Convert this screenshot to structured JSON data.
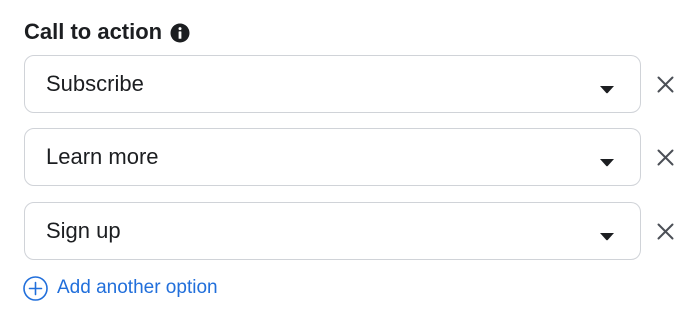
{
  "section": {
    "title": "Call to action",
    "info_icon": "info-icon"
  },
  "options": [
    {
      "value": "Subscribe",
      "dropdown_icon": "caret-down-icon",
      "remove_icon": "close-icon"
    },
    {
      "value": "Learn more",
      "dropdown_icon": "caret-down-icon",
      "remove_icon": "close-icon"
    },
    {
      "value": "Sign up",
      "dropdown_icon": "caret-down-icon",
      "remove_icon": "close-icon"
    }
  ],
  "add_option": {
    "label": "Add another option",
    "icon": "plus-circle-icon"
  },
  "colors": {
    "text": "#1c1e21",
    "border": "#d0d3d8",
    "link": "#216fdb",
    "icon": "#4b4f56"
  }
}
